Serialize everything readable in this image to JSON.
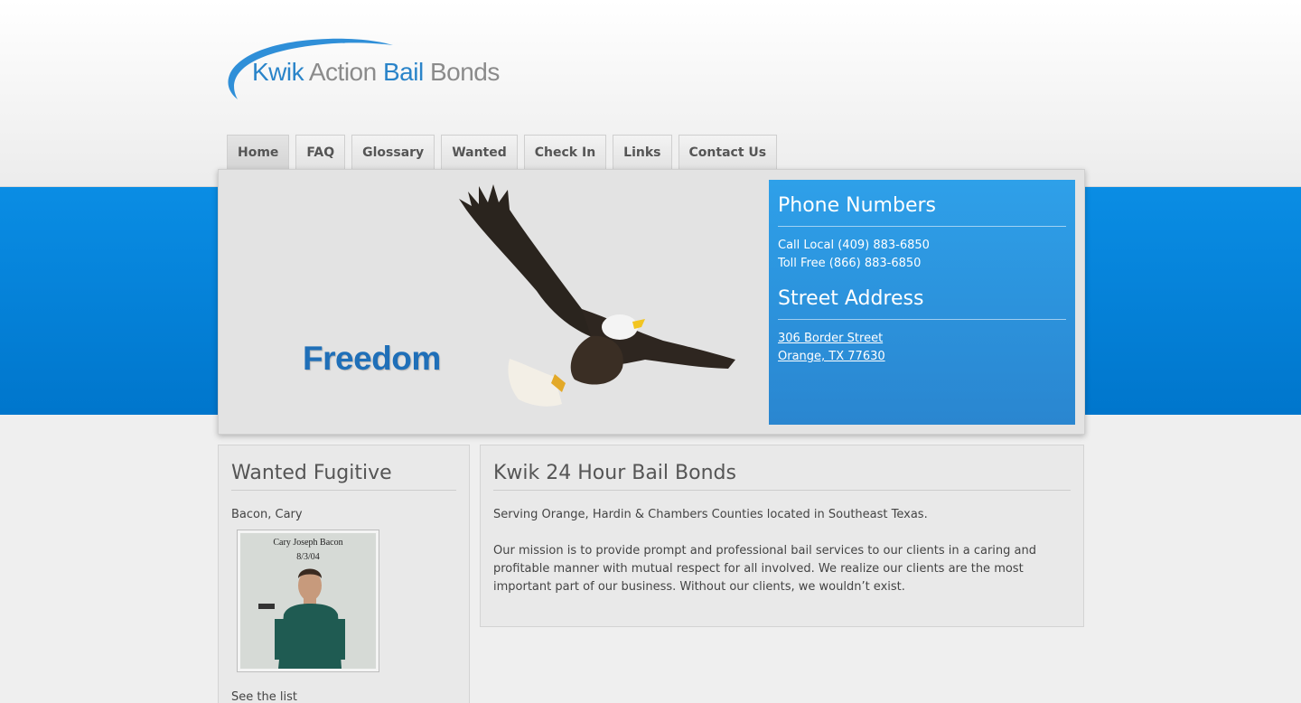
{
  "logo": {
    "part_blue_1": "Kwik",
    "part_gray_1": " Action ",
    "part_blue_2": "Bail",
    "part_gray_2": " Bonds"
  },
  "nav": {
    "items": [
      {
        "label": "Home",
        "active": true
      },
      {
        "label": "FAQ"
      },
      {
        "label": "Glossary"
      },
      {
        "label": "Wanted"
      },
      {
        "label": "Check In"
      },
      {
        "label": "Links"
      },
      {
        "label": "Contact Us"
      }
    ]
  },
  "banner": {
    "slogan": "Freedom",
    "phone_heading": "Phone Numbers",
    "phone_local": "Call Local (409) 883-6850",
    "phone_toll": "Toll Free (866) 883-6850",
    "address_heading": "Street Address",
    "address_line1": "306 Border Street",
    "address_line2": "Orange, TX 77630"
  },
  "wanted": {
    "heading": "Wanted Fugitive",
    "name": "Bacon, Cary",
    "photo_caption_1": "Cary Joseph Bacon",
    "photo_caption_2": "8/3/04",
    "see_list": "See the list"
  },
  "main": {
    "heading": "Kwik 24 Hour Bail Bonds",
    "intro": "Serving Orange, Hardin & Chambers Counties located in Southeast Texas.",
    "mission": "Our mission is to provide prompt and professional bail services to our clients in a caring and profitable manner with mutual respect for all involved. We realize our clients are the most important part of our business. Without our clients, we wouldn’t exist."
  },
  "colors": {
    "band_blue": "#0a8de4",
    "info_box_blue": "#2ea0e9",
    "logo_blue": "#2a84c9",
    "logo_gray": "#8b8b8b"
  }
}
